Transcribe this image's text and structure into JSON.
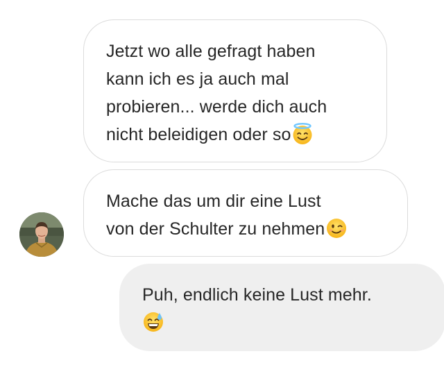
{
  "messages": [
    {
      "direction": "incoming",
      "lines": [
        "Jetzt wo alle gefragt haben",
        "kann ich es ja auch mal",
        "probieren... werde dich auch",
        "nicht beleidigen oder so"
      ],
      "emoji": "smiling-face-with-halo-icon"
    },
    {
      "direction": "incoming",
      "lines": [
        "Mache das um dir eine Lust",
        "von der Schulter zu nehmen"
      ],
      "emoji": "winking-face-icon"
    },
    {
      "direction": "outgoing",
      "lines": [
        "Puh, endlich keine Lust mehr."
      ],
      "emoji": "grinning-face-with-sweat-icon"
    }
  ],
  "sender_avatar": "avatar",
  "colors": {
    "incoming_bubble_bg": "#ffffff",
    "incoming_bubble_border": "#dbdbdb",
    "outgoing_bubble_bg": "#efefef",
    "text": "#262626"
  }
}
